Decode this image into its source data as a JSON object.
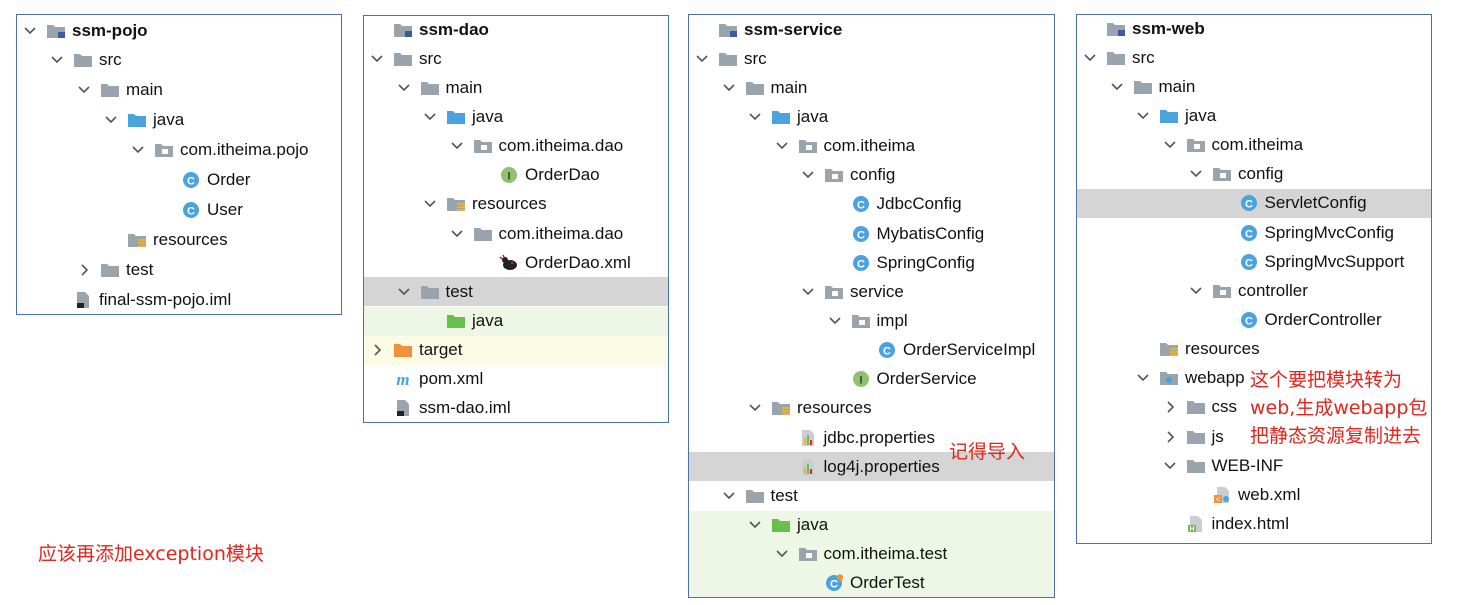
{
  "panels": [
    {
      "id": "pojo",
      "rows": [
        {
          "depth": 0,
          "arrow": "down",
          "icon": "module-folder",
          "label": "ssm-pojo",
          "bold": true
        },
        {
          "depth": 1,
          "arrow": "down",
          "icon": "folder",
          "label": "src"
        },
        {
          "depth": 2,
          "arrow": "down",
          "icon": "folder",
          "label": "main"
        },
        {
          "depth": 3,
          "arrow": "down",
          "icon": "source-folder",
          "label": "java"
        },
        {
          "depth": 4,
          "arrow": "down",
          "icon": "package",
          "label": "com.itheima.pojo"
        },
        {
          "depth": 5,
          "arrow": "none",
          "icon": "class",
          "label": "Order"
        },
        {
          "depth": 5,
          "arrow": "none",
          "icon": "class",
          "label": "User"
        },
        {
          "depth": 3,
          "arrow": "none",
          "icon": "resources-folder",
          "label": "resources"
        },
        {
          "depth": 2,
          "arrow": "right",
          "icon": "folder",
          "label": "test"
        },
        {
          "depth": 1,
          "arrow": "none",
          "icon": "iml-file",
          "label": "final-ssm-pojo.iml"
        }
      ]
    },
    {
      "id": "dao",
      "rows": [
        {
          "depth": 0,
          "arrow": "none",
          "icon": "module-folder",
          "label": "ssm-dao",
          "bold": true
        },
        {
          "depth": 0,
          "arrow": "down",
          "icon": "folder",
          "label": "src"
        },
        {
          "depth": 1,
          "arrow": "down",
          "icon": "folder",
          "label": "main"
        },
        {
          "depth": 2,
          "arrow": "down",
          "icon": "source-folder",
          "label": "java"
        },
        {
          "depth": 3,
          "arrow": "down",
          "icon": "package",
          "label": "com.itheima.dao"
        },
        {
          "depth": 4,
          "arrow": "none",
          "icon": "interface",
          "label": "OrderDao"
        },
        {
          "depth": 2,
          "arrow": "down",
          "icon": "resources-folder",
          "label": "resources"
        },
        {
          "depth": 3,
          "arrow": "down",
          "icon": "folder",
          "label": "com.itheima.dao"
        },
        {
          "depth": 4,
          "arrow": "none",
          "icon": "mybatis-xml",
          "label": "OrderDao.xml"
        },
        {
          "depth": 1,
          "arrow": "down",
          "icon": "folder",
          "label": "test",
          "bg": "gray"
        },
        {
          "depth": 2,
          "arrow": "none",
          "icon": "test-folder",
          "label": "java",
          "bg": "green"
        },
        {
          "depth": 0,
          "arrow": "right",
          "icon": "target-folder",
          "label": "target",
          "bg": "yellow"
        },
        {
          "depth": 0,
          "arrow": "none",
          "icon": "maven",
          "label": "pom.xml"
        },
        {
          "depth": 0,
          "arrow": "none",
          "icon": "iml-file",
          "label": "ssm-dao.iml"
        }
      ]
    },
    {
      "id": "service",
      "rows": [
        {
          "depth": 0,
          "arrow": "none",
          "icon": "module-folder",
          "label": "ssm-service",
          "bold": true
        },
        {
          "depth": 0,
          "arrow": "down",
          "icon": "folder",
          "label": "src"
        },
        {
          "depth": 1,
          "arrow": "down",
          "icon": "folder",
          "label": "main"
        },
        {
          "depth": 2,
          "arrow": "down",
          "icon": "source-folder",
          "label": "java"
        },
        {
          "depth": 3,
          "arrow": "down",
          "icon": "package",
          "label": "com.itheima"
        },
        {
          "depth": 4,
          "arrow": "down",
          "icon": "package",
          "label": "config"
        },
        {
          "depth": 5,
          "arrow": "none",
          "icon": "class",
          "label": "JdbcConfig"
        },
        {
          "depth": 5,
          "arrow": "none",
          "icon": "class",
          "label": "MybatisConfig"
        },
        {
          "depth": 5,
          "arrow": "none",
          "icon": "class",
          "label": "SpringConfig"
        },
        {
          "depth": 4,
          "arrow": "down",
          "icon": "package",
          "label": "service"
        },
        {
          "depth": 5,
          "arrow": "down",
          "icon": "package",
          "label": "impl"
        },
        {
          "depth": 6,
          "arrow": "none",
          "icon": "class",
          "label": "OrderServiceImpl"
        },
        {
          "depth": 5,
          "arrow": "none",
          "icon": "interface",
          "label": "OrderService"
        },
        {
          "depth": 2,
          "arrow": "down",
          "icon": "resources-folder",
          "label": "resources"
        },
        {
          "depth": 3,
          "arrow": "none",
          "icon": "properties",
          "label": "jdbc.properties"
        },
        {
          "depth": 3,
          "arrow": "none",
          "icon": "properties",
          "label": "log4j.properties",
          "bg": "gray"
        },
        {
          "depth": 1,
          "arrow": "down",
          "icon": "folder",
          "label": "test"
        },
        {
          "depth": 2,
          "arrow": "down",
          "icon": "test-folder",
          "label": "java",
          "bg": "green"
        },
        {
          "depth": 3,
          "arrow": "down",
          "icon": "package",
          "label": "com.itheima.test",
          "bg": "green"
        },
        {
          "depth": 4,
          "arrow": "none",
          "icon": "test-class",
          "label": "OrderTest",
          "bg": "green"
        }
      ]
    },
    {
      "id": "web",
      "rows": [
        {
          "depth": 0,
          "arrow": "none",
          "icon": "module-folder",
          "label": "ssm-web",
          "bold": true
        },
        {
          "depth": 0,
          "arrow": "down",
          "icon": "folder",
          "label": "src"
        },
        {
          "depth": 1,
          "arrow": "down",
          "icon": "folder",
          "label": "main"
        },
        {
          "depth": 2,
          "arrow": "down",
          "icon": "source-folder",
          "label": "java"
        },
        {
          "depth": 3,
          "arrow": "down",
          "icon": "package",
          "label": "com.itheima"
        },
        {
          "depth": 4,
          "arrow": "down",
          "icon": "package",
          "label": "config"
        },
        {
          "depth": 5,
          "arrow": "none",
          "icon": "class",
          "label": "ServletConfig",
          "bg": "gray"
        },
        {
          "depth": 5,
          "arrow": "none",
          "icon": "class",
          "label": "SpringMvcConfig"
        },
        {
          "depth": 5,
          "arrow": "none",
          "icon": "class",
          "label": "SpringMvcSupport"
        },
        {
          "depth": 4,
          "arrow": "down",
          "icon": "package",
          "label": "controller"
        },
        {
          "depth": 5,
          "arrow": "none",
          "icon": "class",
          "label": "OrderController"
        },
        {
          "depth": 2,
          "arrow": "none",
          "icon": "resources-folder",
          "label": "resources"
        },
        {
          "depth": 2,
          "arrow": "down",
          "icon": "web-folder",
          "label": "webapp"
        },
        {
          "depth": 3,
          "arrow": "right",
          "icon": "folder",
          "label": "css"
        },
        {
          "depth": 3,
          "arrow": "right",
          "icon": "folder",
          "label": "js"
        },
        {
          "depth": 3,
          "arrow": "down",
          "icon": "folder",
          "label": "WEB-INF"
        },
        {
          "depth": 4,
          "arrow": "none",
          "icon": "web-xml",
          "label": "web.xml"
        },
        {
          "depth": 3,
          "arrow": "none",
          "icon": "html-file",
          "label": "index.html"
        }
      ]
    }
  ],
  "notes": {
    "service_import": "记得导入",
    "webapp_line1": "这个要把模块转为",
    "webapp_line2": "web,生成webapp包",
    "webapp_line3": "把静态资源复制进去",
    "exception": "应该再添加exception模块"
  },
  "colors": {
    "panel_border": "#4a6fb5",
    "note_red": "#e8231b",
    "highlight_gray": "#d5d5d5",
    "test_green": "#eef7e6",
    "target_yellow": "#fbfbe6"
  }
}
